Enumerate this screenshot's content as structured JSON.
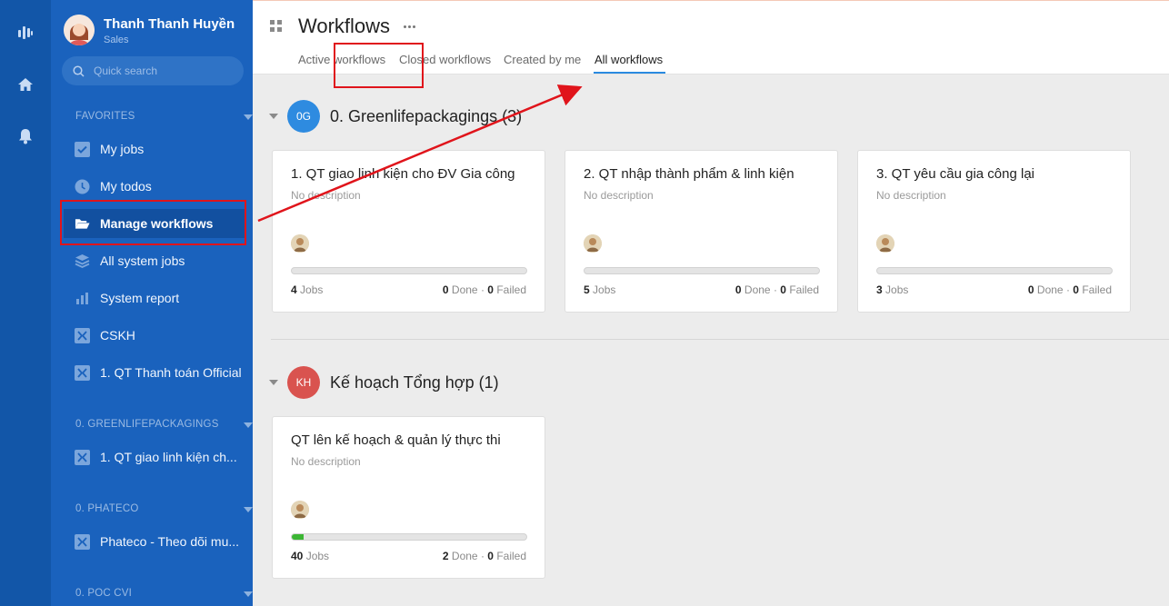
{
  "user": {
    "name": "Thanh Thanh Huyền",
    "role": "Sales"
  },
  "search": {
    "placeholder": "Quick search"
  },
  "sidebar": {
    "favorites_label": "FAVORITES",
    "favorites": [
      {
        "label": "My jobs",
        "icon": "checkbox-icon"
      },
      {
        "label": "My todos",
        "icon": "clock-icon"
      },
      {
        "label": "Manage workflows",
        "icon": "folder-open-icon"
      },
      {
        "label": "All system jobs",
        "icon": "layers-icon"
      },
      {
        "label": "System report",
        "icon": "bar-chart-icon"
      },
      {
        "label": "CSKH",
        "icon": "workflow-icon"
      },
      {
        "label": "1. QT Thanh toán Official",
        "icon": "workflow-icon"
      }
    ],
    "sections": [
      {
        "label": "0. GREENLIFEPACKAGINGS",
        "items": [
          {
            "label": "1. QT giao linh kiện ch...",
            "icon": "workflow-icon"
          }
        ]
      },
      {
        "label": "0. PHATECO",
        "items": [
          {
            "label": "Phateco - Theo dõi mu...",
            "icon": "workflow-icon"
          }
        ]
      },
      {
        "label": "0. POC CVI",
        "items": []
      }
    ]
  },
  "header": {
    "title": "Workflows",
    "tabs": [
      {
        "label": "Active workflows"
      },
      {
        "label": "Closed workflows"
      },
      {
        "label": "Created by me"
      },
      {
        "label": "All workflows"
      }
    ]
  },
  "groups": [
    {
      "badge": "0G",
      "badge_color": "#2e8be0",
      "title": "0. Greenlifepackagings (3)",
      "cards": [
        {
          "title": "1. QT giao linh kiện cho ĐV Gia công",
          "desc": "No description",
          "jobs": "4",
          "jobs_label": "Jobs",
          "done": "0",
          "done_label": "Done",
          "failed": "0",
          "failed_label": "Failed",
          "progress": 0
        },
        {
          "title": "2. QT nhập thành phẩm & linh kiện",
          "desc": "No description",
          "jobs": "5",
          "jobs_label": "Jobs",
          "done": "0",
          "done_label": "Done",
          "failed": "0",
          "failed_label": "Failed",
          "progress": 0
        },
        {
          "title": "3. QT yêu cầu gia công lại",
          "desc": "No description",
          "jobs": "3",
          "jobs_label": "Jobs",
          "done": "0",
          "done_label": "Done",
          "failed": "0",
          "failed_label": "Failed",
          "progress": 0
        }
      ]
    },
    {
      "badge": "KH",
      "badge_color": "#d9534f",
      "title": "Kế hoạch Tổng hợp (1)",
      "cards": [
        {
          "title": "QT lên kế hoạch & quản lý thực thi",
          "desc": "No description",
          "jobs": "40",
          "jobs_label": "Jobs",
          "done": "2",
          "done_label": "Done",
          "failed": "0",
          "failed_label": "Failed",
          "progress": 0.05
        }
      ]
    }
  ],
  "colors": {
    "rail": "#1256a8",
    "sidebar": "#1a62bd",
    "highlight": "#e0141b",
    "tab_accent": "#2a8ae0",
    "progress": "#3cb634"
  }
}
